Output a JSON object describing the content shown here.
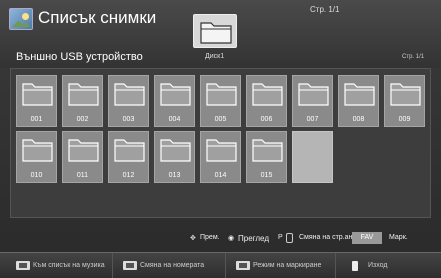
{
  "header": {
    "title": "Списък снимки",
    "page_indicator": "Стр. 1/1",
    "device_title": "Външно USB устройство",
    "device_name": "Диск1",
    "page_indicator_small": "Стр. 1/1"
  },
  "folders": [
    "001",
    "002",
    "003",
    "004",
    "005",
    "006",
    "007",
    "008",
    "009",
    "010",
    "011",
    "012",
    "013",
    "014",
    "015"
  ],
  "hints": {
    "move": "Прем.",
    "view": "Преглед",
    "p_label": "P",
    "page_change": "Смяна на стр.аница",
    "fav": "FAV",
    "mark": "Марк."
  },
  "footer": {
    "to_music": "Към списък на музика",
    "change_numbers": "Смяна на номерата",
    "mark_mode": "Режим на маркиране",
    "exit": "Изход"
  }
}
